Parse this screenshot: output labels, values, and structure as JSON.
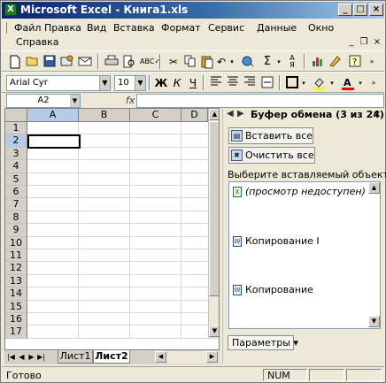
{
  "window": {
    "title": "Microsoft Excel - Книга1.xls",
    "app_icon_letter": "X",
    "buttons": {
      "minimize": "_",
      "maximize": "□",
      "close": "×"
    }
  },
  "menu": {
    "items": [
      "Файл",
      "Правка",
      "Вид",
      "Вставка",
      "Формат",
      "Сервис",
      "Данные",
      "Окно"
    ],
    "help": "Справка",
    "mdi_buttons": {
      "minimize": "_",
      "restore": "❐",
      "close": "×"
    }
  },
  "toolbar_standard": {
    "icons": [
      "new-icon",
      "open-icon",
      "save-icon",
      "permission-icon",
      "email-icon",
      "print-icon",
      "print-preview-icon",
      "spelling-icon",
      "cut-icon",
      "copy-icon",
      "paste-icon",
      "undo-icon",
      "sum-icon",
      "sort-asc-icon",
      "chart-wizard-icon",
      "drawing-icon",
      "help-icon"
    ],
    "sum_symbol": "Σ"
  },
  "toolbar_formatting": {
    "font_name": "Arial Cyr",
    "font_size": "10",
    "bold": "Ж",
    "italic": "К",
    "underline": "Ч",
    "colors": {
      "fill": "#ffff00",
      "font": "#ff0000"
    }
  },
  "formula_bar": {
    "name_box": "A2",
    "fx": "fx",
    "value": ""
  },
  "grid": {
    "columns": [
      "A",
      "B",
      "C",
      "D"
    ],
    "rows": [
      "1",
      "2",
      "3",
      "4",
      "5",
      "6",
      "7",
      "8",
      "9",
      "10",
      "11",
      "12",
      "13",
      "14",
      "15",
      "16",
      "17"
    ],
    "active_cell": "A2"
  },
  "sheet_tabs": {
    "tabs": [
      "Лист1",
      "Лист2"
    ],
    "active": "Лист2"
  },
  "task_pane": {
    "title": "Буфер обмена (3 из 24)",
    "paste_all": "Вставить все",
    "clear_all": "Очистить все",
    "prompt": "Выберите вставляемый объект:",
    "items": [
      {
        "icon": "excel-clip-icon",
        "text": "(просмотр недоступен)"
      },
      {
        "icon": "word-clip-icon",
        "text": "Копирование I"
      },
      {
        "icon": "word-clip-icon",
        "text": "Копирование"
      }
    ],
    "options": "Параметры ▾"
  },
  "status": {
    "text": "Готово",
    "num": "NUM"
  }
}
